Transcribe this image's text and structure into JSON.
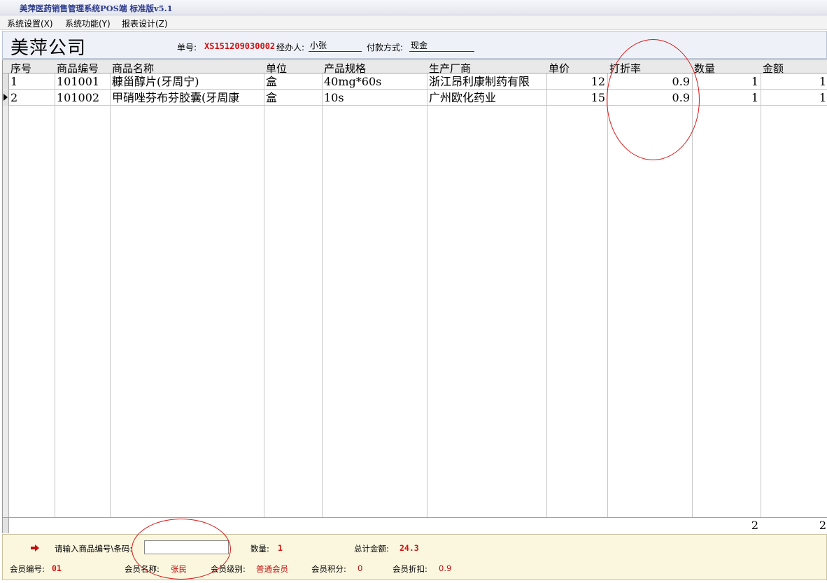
{
  "window": {
    "title": "美萍医药销售管理系统POS端 标准版v5.1"
  },
  "menu": [
    {
      "label": "系统设置(X)"
    },
    {
      "label": "系统功能(Y)"
    },
    {
      "label": "报表设计(Z)"
    }
  ],
  "header": {
    "company": "美萍公司",
    "order_label": "单号:",
    "order_no": "XS151209030002",
    "handler_label": "经办人:",
    "handler": "小张",
    "payment_label": "付款方式:",
    "payment": "现金"
  },
  "table": {
    "columns": [
      "序号",
      "商品编号",
      "商品名称",
      "单位",
      "产品规格",
      "生产厂商",
      "单价",
      "打折率",
      "数量",
      "金额"
    ],
    "rows": [
      {
        "seq": "1",
        "code": "101001",
        "name": "糠甾醇片(牙周宁)",
        "unit": "盒",
        "spec": "40mg*60s",
        "maker": "浙江昂利康制药有限",
        "price": "12",
        "discount": "0.9",
        "qty": "1",
        "amount": "1"
      },
      {
        "seq": "2",
        "code": "101002",
        "name": "甲硝唑芬布芬胶囊(牙周康",
        "unit": "盒",
        "spec": "10s",
        "maker": "广州欧化药业",
        "price": "15",
        "discount": "0.9",
        "qty": "1",
        "amount": "1"
      }
    ],
    "totals": {
      "qty": "2",
      "amount": "2"
    }
  },
  "bottom": {
    "barcode_label": "请输入商品编号\\条码:",
    "barcode_value": "",
    "qty_label": "数量:",
    "qty": "1",
    "total_label": "总计金额:",
    "total": "24.3",
    "member_no_label": "会员编号:",
    "member_no": "01",
    "member_name_label": "会员名称:",
    "member_name": "张民",
    "member_level_label": "会员级别:",
    "member_level": "普通会员",
    "member_points_label": "会员积分:",
    "member_points": "0",
    "member_discount_label": "会员折扣:",
    "member_discount": "0.9"
  },
  "icons": {
    "row_pointer": "row-pointer-icon",
    "enter_arrow": "arrow-right-icon"
  },
  "colors": {
    "accent_red": "#d21010",
    "annotation": "#d81818",
    "panel_bg": "#fbf7df"
  }
}
